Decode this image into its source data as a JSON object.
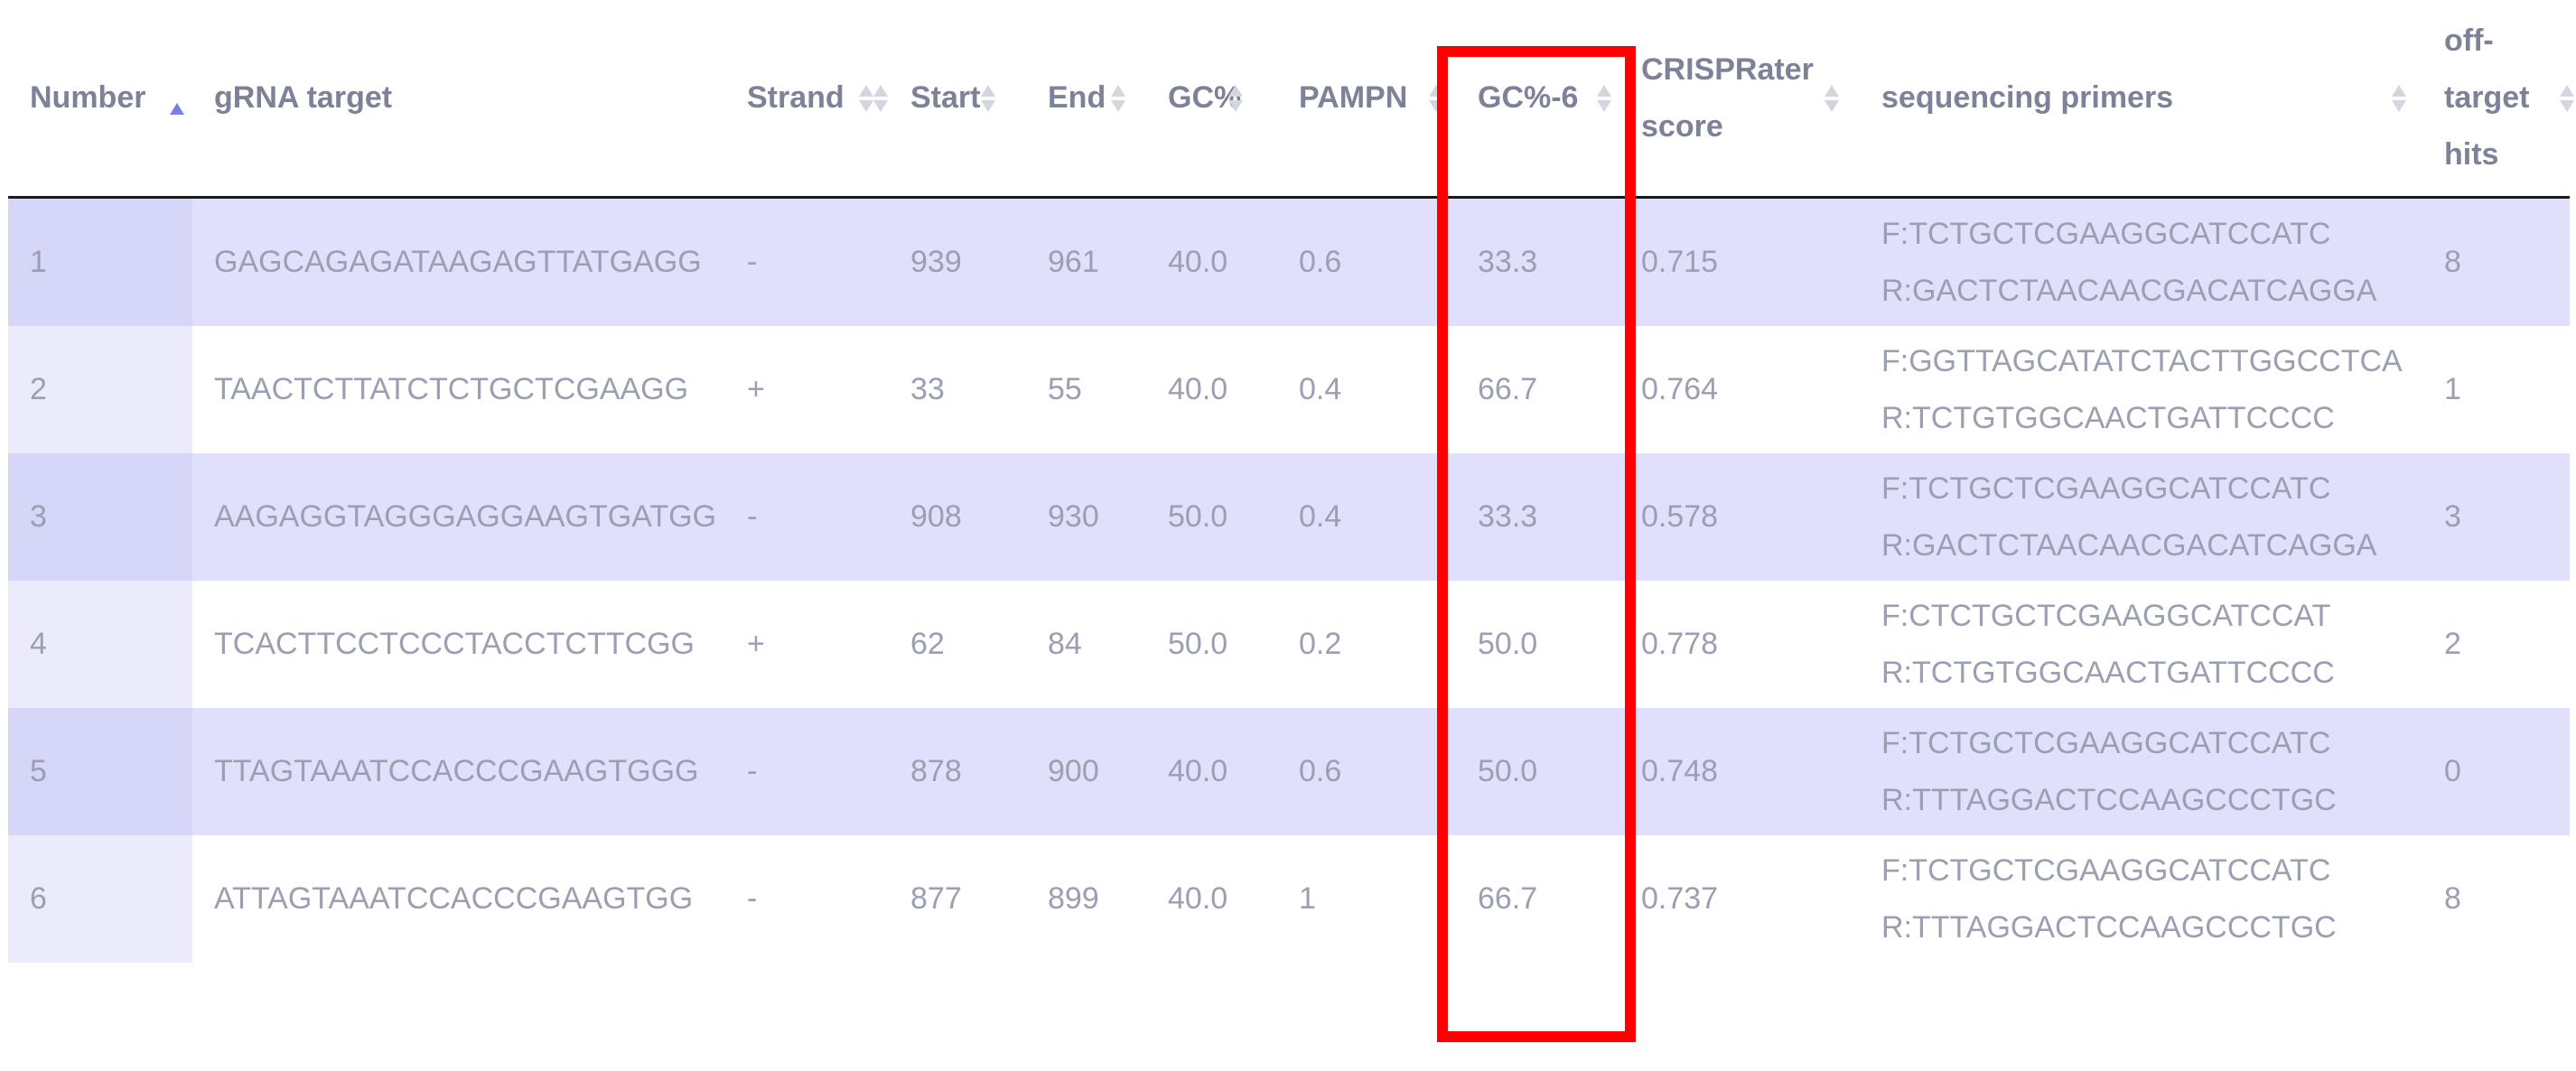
{
  "columns": [
    {
      "key": "number",
      "label": "Number",
      "sort": "asc"
    },
    {
      "key": "gRNA",
      "label": "gRNA target",
      "sort": "none"
    },
    {
      "key": "strand",
      "label": "Strand",
      "sort": "none"
    },
    {
      "key": "start",
      "label": "Start",
      "sort": "none"
    },
    {
      "key": "end",
      "label": "End",
      "sort": "none"
    },
    {
      "key": "gc",
      "label": "GC%",
      "sort": "none"
    },
    {
      "key": "pampn",
      "label": "PAMPN",
      "sort": "none"
    },
    {
      "key": "gc6",
      "label": "GC%-6",
      "sort": "none"
    },
    {
      "key": "crisprater",
      "label": "CRISPRater score",
      "sort": "none"
    },
    {
      "key": "primers",
      "label": "sequencing primers",
      "sort": "none"
    },
    {
      "key": "offtarget",
      "label": "off-target hits",
      "sort": "none"
    }
  ],
  "rows": [
    {
      "number": "1",
      "gRNA": "GAGCAGAGATAAGAGTTATGAGG",
      "strand": "-",
      "start": "939",
      "end": "961",
      "gc": "40.0",
      "pampn": "0.6",
      "gc6": "33.3",
      "crisprater": "0.715",
      "primer_f": "F:TCTGCTCGAAGGCATCCATC",
      "primer_r": "R:GACTCTAACAACGACATCAGGA",
      "offtarget": "8"
    },
    {
      "number": "2",
      "gRNA": "TAACTCTTATCTCTGCTCGAAGG",
      "strand": "+",
      "start": "33",
      "end": "55",
      "gc": "40.0",
      "pampn": "0.4",
      "gc6": "66.7",
      "crisprater": "0.764",
      "primer_f": "F:GGTTAGCATATCTACTTGGCCTCA",
      "primer_r": "R:TCTGTGGCAACTGATTCCCC",
      "offtarget": "1"
    },
    {
      "number": "3",
      "gRNA": "AAGAGGTAGGGAGGAAGTGATGG",
      "strand": "-",
      "start": "908",
      "end": "930",
      "gc": "50.0",
      "pampn": "0.4",
      "gc6": "33.3",
      "crisprater": "0.578",
      "primer_f": "F:TCTGCTCGAAGGCATCCATC",
      "primer_r": "R:GACTCTAACAACGACATCAGGA",
      "offtarget": "3"
    },
    {
      "number": "4",
      "gRNA": "TCACTTCCTCCCTACCTCTTCGG",
      "strand": "+",
      "start": "62",
      "end": "84",
      "gc": "50.0",
      "pampn": "0.2",
      "gc6": "50.0",
      "crisprater": "0.778",
      "primer_f": "F:CTCTGCTCGAAGGCATCCAT",
      "primer_r": "R:TCTGTGGCAACTGATTCCCC",
      "offtarget": "2"
    },
    {
      "number": "5",
      "gRNA": "TTAGTAAATCCACCCGAAGTGGG",
      "strand": "-",
      "start": "878",
      "end": "900",
      "gc": "40.0",
      "pampn": "0.6",
      "gc6": "50.0",
      "crisprater": "0.748",
      "primer_f": "F:TCTGCTCGAAGGCATCCATC",
      "primer_r": "R:TTTAGGACTCCAAGCCCTGC",
      "offtarget": "0"
    },
    {
      "number": "6",
      "gRNA": "ATTAGTAAATCCACCCGAAGTGG",
      "strand": "-",
      "start": "877",
      "end": "899",
      "gc": "40.0",
      "pampn": "1",
      "gc6": "66.7",
      "crisprater": "0.737",
      "primer_f": "F:TCTGCTCGAAGGCATCCATC",
      "primer_r": "R:TTTAGGACTCCAAGCCCTGC",
      "offtarget": "8"
    }
  ],
  "highlighted_column": "gc6",
  "colors": {
    "header_text": "#7d8299",
    "cell_text": "#9a9fb2",
    "row_odd": "#e0e0fc",
    "row_even": "#ffffff",
    "sort_active": "#7b7fe6",
    "highlight_border": "#ff0000"
  }
}
